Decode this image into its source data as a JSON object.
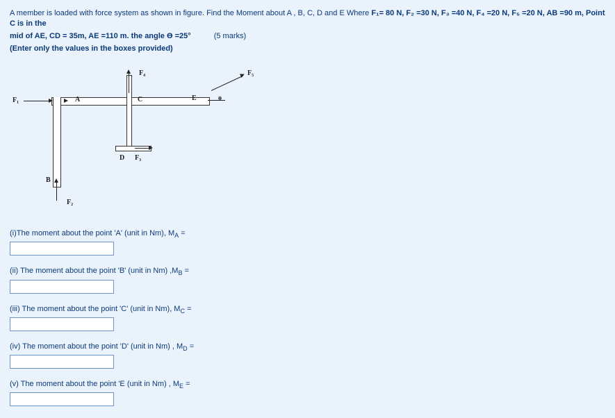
{
  "problem": {
    "line1_pre": "A member is loaded with force system as shown in figure. Find the Moment about A , B, C, D and E  Where ",
    "f1": "F₁= 80 N, F₂ =30 N, F₃ =40 N, F₄ =20 N, F₅ =20 N, AB =90  m, Point C is in the",
    "line2_pre": "mid of AE, CD = 35m, AE =110 m. the angle Ө =25°",
    "marks": "(5 marks)",
    "instruction": "(Enter only the values in the boxes provided)"
  },
  "figure": {
    "F1": "F₁",
    "F2": "F₂",
    "F3": "F₃",
    "F4": "F₄",
    "F5": "F₅",
    "A": "A",
    "B": "B",
    "C": "C",
    "D": "D",
    "E": "E",
    "theta": "ө"
  },
  "questions": {
    "q1": "(i)The moment about the point 'A' (unit in Nm), M",
    "q1sub": "A",
    "q1eq": " =",
    "q2": "(ii) The moment about the point 'B' (unit in Nm) ,M",
    "q2sub": "B",
    "q2eq": " =",
    "q3": "(iii) The moment about the point 'C' (unit in Nm), M",
    "q3sub": "C",
    "q3eq": " =",
    "q4": "(iv) The moment about the point 'D' (unit in Nm) , M",
    "q4sub": "D",
    "q4eq": " =",
    "q5": "(v) The moment about the point 'E (unit in Nm) , M",
    "q5sub": "E",
    "q5eq": " ="
  }
}
